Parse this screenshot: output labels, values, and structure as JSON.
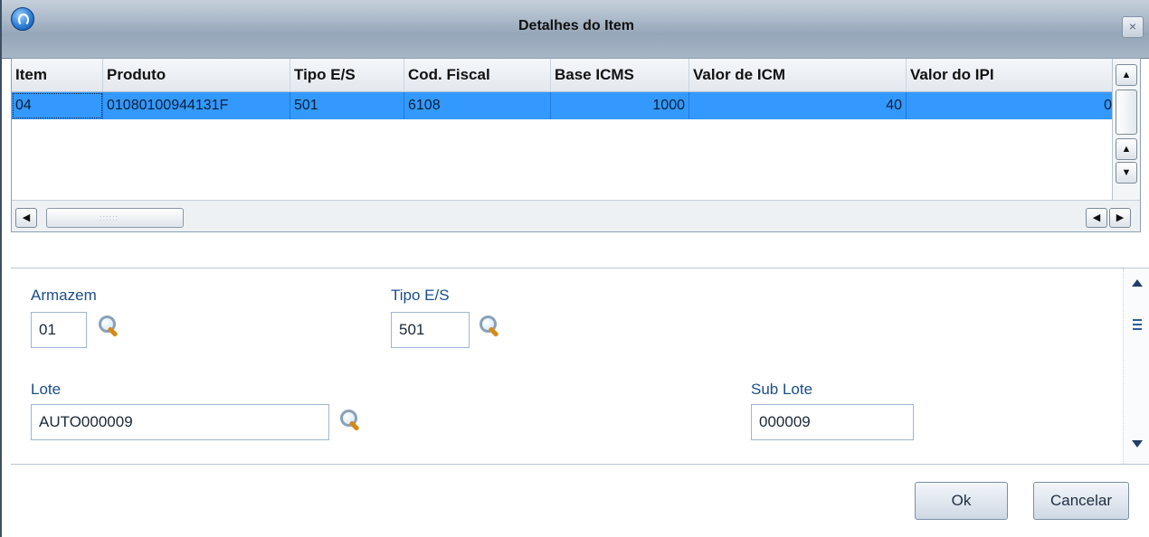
{
  "window": {
    "title": "Detalhes do Item",
    "close_glyph": "×"
  },
  "grid": {
    "columns": [
      "Item",
      "Produto",
      "Tipo E/S",
      "Cod. Fiscal",
      "Base ICMS",
      "Valor de ICM",
      "Valor do IPI"
    ],
    "rows": [
      {
        "item": "04",
        "produto": "01080100944131F",
        "tipo_es": "501",
        "cod_fiscal": "6108",
        "base_icms": "1000",
        "valor_icm": "40",
        "valor_ipi": "0"
      }
    ]
  },
  "form": {
    "armazem": {
      "label": "Armazem",
      "value": "01"
    },
    "tipo_es": {
      "label": "Tipo E/S",
      "value": "501"
    },
    "lote": {
      "label": "Lote",
      "value": "AUTO000009"
    },
    "sub_lote": {
      "label": "Sub Lote",
      "value": "000009"
    }
  },
  "buttons": {
    "ok": "Ok",
    "cancel": "Cancelar"
  },
  "icons": [
    "app-logo-icon",
    "close-icon",
    "scroll-up-icon",
    "scroll-down-icon",
    "scroll-left-icon",
    "scroll-right-icon",
    "magnifier-icon"
  ]
}
